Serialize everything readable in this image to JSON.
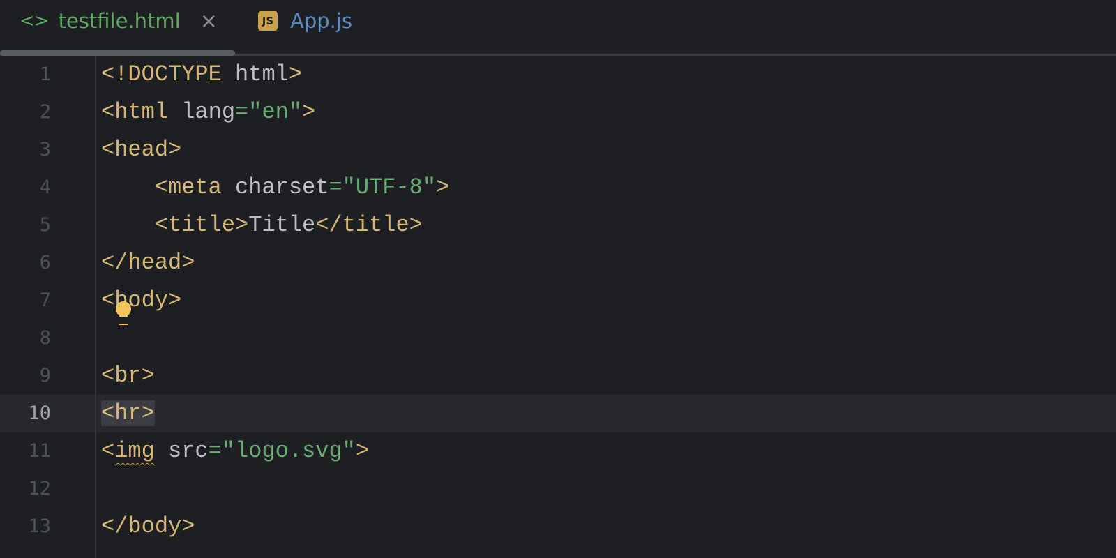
{
  "tabs": [
    {
      "label": "testfile.html",
      "icon": "html-icon",
      "active": true,
      "close": "×"
    },
    {
      "label": "App.js",
      "icon": "js-icon",
      "icon_text": "JS"
    }
  ],
  "colors": {
    "tag": "#d5b778",
    "attr": "#bcbec4",
    "string": "#6aab73",
    "background": "#1e1f22",
    "current_line": "#26282e"
  },
  "editor": {
    "current_line": 10,
    "lines": [
      {
        "n": "1",
        "tokens": [
          [
            "tag",
            "<!DOCTYPE "
          ],
          [
            "attr",
            "html"
          ],
          [
            "tag",
            ">"
          ]
        ]
      },
      {
        "n": "2",
        "tokens": [
          [
            "tag",
            "<html "
          ],
          [
            "attr",
            "lang"
          ],
          [
            "str",
            "=\"en\""
          ],
          [
            "tag",
            ">"
          ]
        ]
      },
      {
        "n": "3",
        "tokens": [
          [
            "tag",
            "<head>"
          ]
        ]
      },
      {
        "n": "4",
        "tokens": [
          [
            "txt",
            "    "
          ],
          [
            "tag",
            "<meta "
          ],
          [
            "attr",
            "charset"
          ],
          [
            "str",
            "=\"UTF-8\""
          ],
          [
            "tag",
            ">"
          ]
        ]
      },
      {
        "n": "5",
        "tokens": [
          [
            "txt",
            "    "
          ],
          [
            "tag",
            "<title>"
          ],
          [
            "txt",
            "Title"
          ],
          [
            "tag",
            "</title>"
          ]
        ]
      },
      {
        "n": "6",
        "tokens": [
          [
            "tag",
            "</head>"
          ]
        ]
      },
      {
        "n": "7",
        "tokens": [
          [
            "tag",
            "<body>"
          ]
        ]
      },
      {
        "n": "8",
        "tokens": []
      },
      {
        "n": "9",
        "tokens": [
          [
            "tag",
            "<br>"
          ]
        ]
      },
      {
        "n": "10",
        "tokens": [
          [
            "tag hl",
            "<hr>"
          ]
        ]
      },
      {
        "n": "11",
        "tokens": [
          [
            "tag",
            "<"
          ],
          [
            "tag warn",
            "img"
          ],
          [
            "attr",
            " src"
          ],
          [
            "str",
            "=\"logo.svg\""
          ],
          [
            "tag",
            ">"
          ]
        ]
      },
      {
        "n": "12",
        "tokens": []
      },
      {
        "n": "13",
        "tokens": [
          [
            "tag",
            "</body>"
          ]
        ]
      }
    ]
  }
}
